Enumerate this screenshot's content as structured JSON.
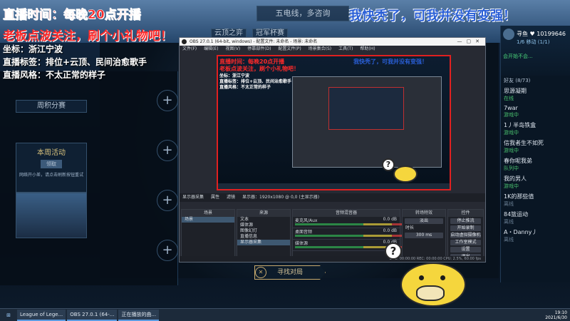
{
  "overlay": {
    "title": "直播时间：每晚20点开播",
    "subtitle": "老板点波关注，刷个小礼物吧！",
    "location": "坐标：浙江宁波",
    "tags": "直播标签：排位+云顶、民间治愈歌手",
    "style": "直播风格：不太正常的样子",
    "right_banner": "我快秃了，可我并没有变强！"
  },
  "game_client": {
    "top_text_1": "五电线，多咨询",
    "top_text_2": "云顶之弈",
    "top_text_3": "冠军杯赛",
    "weekly_share": "周积分赛",
    "event_label": "本周活动",
    "event_btn": "领取",
    "event_desc": "网络开小差，请点击刷新按钮重试",
    "find_match": "寻找对局",
    "close": "✕",
    "plus": "+"
  },
  "friends": {
    "name": "寻鱼 ♥ 10199646",
    "level": "1/6 移动 (1/1)",
    "status_label": "会开始不会...",
    "group_label": "好友 (8/73)",
    "items": [
      {
        "name": "思源凝期",
        "status": "在线",
        "online": true
      },
      {
        "name": "7war",
        "status": "游戏中",
        "online": true
      },
      {
        "name": "1丿半岛铁盒",
        "status": "游戏中",
        "online": true
      },
      {
        "name": "信我者生不如死",
        "status": "游戏中",
        "online": true
      },
      {
        "name": "春你呢我弟",
        "status": "队列中",
        "online": true
      },
      {
        "name": "我的男人",
        "status": "游戏中",
        "online": true
      },
      {
        "name": "1K的那些值",
        "status": "离线",
        "online": false
      },
      {
        "name": "84篮运动",
        "status": "离线",
        "online": false
      },
      {
        "name": "A・Danny丿",
        "status": "离线",
        "online": false
      }
    ]
  },
  "obs": {
    "title": "OBS 27.0.1 (64-bit, windows) - 配置文件: 未命名 - 场景: 未命名",
    "menu": [
      "文件(F)",
      "编辑(E)",
      "视图(V)",
      "停靠部件(D)",
      "配置文件(P)",
      "场景集合(S)",
      "工具(T)",
      "帮助(H)"
    ],
    "scene_bar": [
      "显示器采集",
      "属性",
      "滤镜",
      "显示器：1920x1080 @ 0,0 (主显示器)"
    ],
    "scenes_header": "场景",
    "scenes": [
      "场景"
    ],
    "sources_header": "来源",
    "sources": [
      "文本",
      "媒体源",
      "图像幻灯",
      "直播信息",
      "显示器采集"
    ],
    "mixer_header": "音频混音器",
    "mixer": [
      {
        "name": "麦克风/Aux",
        "level": "0.0 dB"
      },
      {
        "name": "桌面音频",
        "level": "0.0 dB"
      },
      {
        "name": "媒体源",
        "level": "0.0 dB"
      }
    ],
    "transitions_header": "转场特效",
    "transition_value": "淡出",
    "duration_label": "时长",
    "duration_value": "300 ms",
    "controls_header": "控件",
    "controls": [
      "停止推流",
      "开始录制",
      "启动虚拟摄像机",
      "工作室模式",
      "设置",
      "退出"
    ],
    "status": "LIVE: 00:00:00   REC: 00:00:00   CPU: 2.5%, 60.00 fps"
  },
  "preview_texts": {
    "t1": "直播时间：每晚20点开播",
    "t2": "老板点波关注，刷个小礼物吧！",
    "t3": "坐标：浙江宁波",
    "t4": "直播标签：排位+云顶、民间治愈歌手",
    "t5": "直播风格：不太正常的样子",
    "t6": "我快秃了，可我并没有变强！"
  },
  "taskbar": {
    "items": [
      "League of Lege...",
      "OBS 27.0.1 (64-...",
      "正在播放的曲..."
    ],
    "time": "19:10",
    "date": "2021/6/30"
  },
  "duck": {
    "question": "?"
  }
}
